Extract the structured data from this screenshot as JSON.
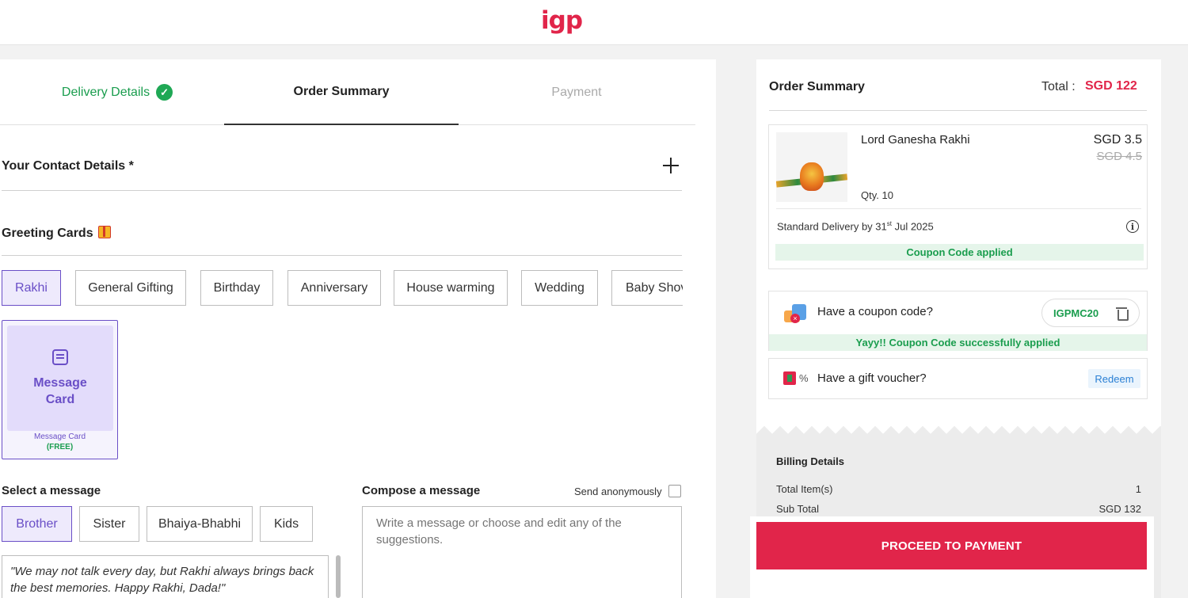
{
  "header": {
    "logo": "igp"
  },
  "steps": {
    "delivery": "Delivery Details",
    "summary": "Order Summary",
    "payment": "Payment"
  },
  "contact": {
    "title": "Your Contact Details *"
  },
  "greeting": {
    "title": "Greeting Cards",
    "categories": [
      "Rakhi",
      "General Gifting",
      "Birthday",
      "Anniversary",
      "House warming",
      "Wedding",
      "Baby Shov"
    ],
    "selected_category": "Rakhi",
    "card": {
      "title": "Message Card",
      "subtitle": "Message Card",
      "price": "(FREE)"
    }
  },
  "message": {
    "select_label": "Select a message",
    "compose_label": "Compose a message",
    "anonymous_label": "Send anonymously",
    "recipients": [
      "Brother",
      "Sister",
      "Bhaiya-Bhabhi",
      "Kids"
    ],
    "selected_recipient": "Brother",
    "suggestion": "\"We may not talk every day, but Rakhi always brings back the best memories. Happy Rakhi, Dada!\"",
    "compose_placeholder": "Write a message or choose and edit any of the suggestions."
  },
  "summary": {
    "title": "Order Summary",
    "total_label": "Total :",
    "total_value": "SGD 122",
    "product": {
      "name": "Lord Ganesha Rakhi",
      "qty": "Qty. 10",
      "price": "SGD 3.5",
      "old_price": "SGD 4.5",
      "delivery_prefix": "Standard Delivery by 31",
      "delivery_sup": "st",
      "delivery_suffix": " Jul 2025",
      "coupon_status": "Coupon Code applied"
    },
    "coupon": {
      "label": "Have a coupon code?",
      "code": "IGPMC20",
      "success": "Yayy!! Coupon Code successfully applied"
    },
    "voucher": {
      "label": "Have a gift voucher?",
      "percent": "%",
      "action": "Redeem"
    },
    "billing": {
      "title": "Billing Details",
      "rows": [
        {
          "label": "Total Item(s)",
          "value": "1"
        },
        {
          "label": "Sub Total",
          "value": "SGD 132"
        }
      ]
    },
    "proceed": "PROCEED TO PAYMENT"
  },
  "colors": {
    "brand": "#e1254a",
    "success": "#1a9d4e",
    "accent": "#6a4fc7"
  }
}
